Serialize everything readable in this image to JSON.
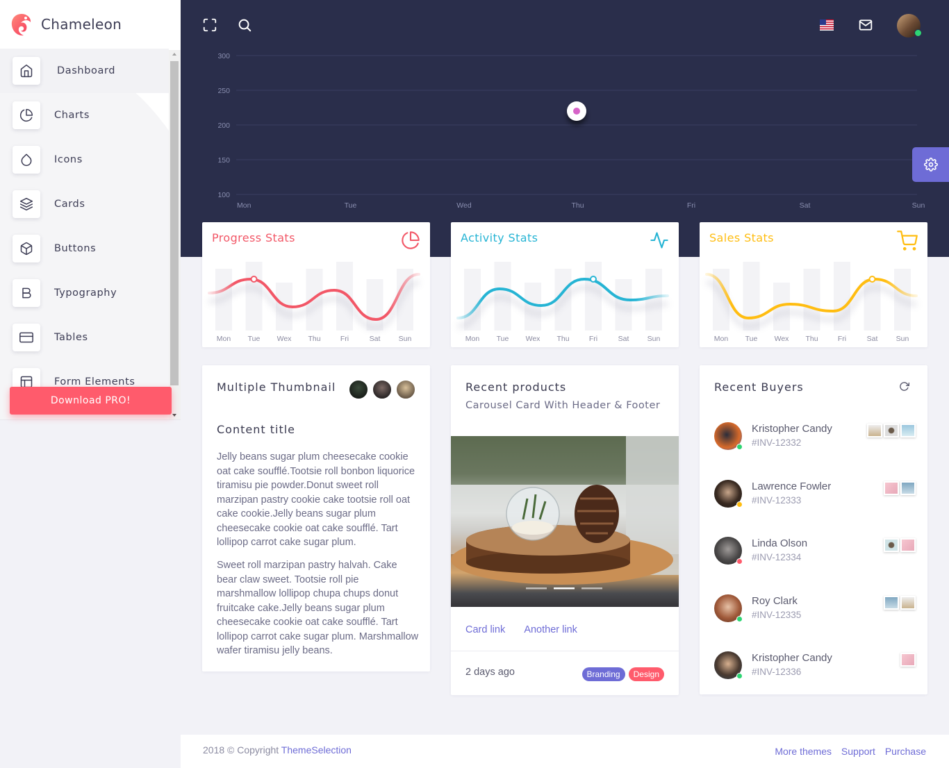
{
  "brand": {
    "name": "Chameleon"
  },
  "sidebar": {
    "items": [
      {
        "label": "Dashboard",
        "icon": "home-icon"
      },
      {
        "label": "Charts",
        "icon": "pie-chart-icon"
      },
      {
        "label": "Icons",
        "icon": "droplet-icon"
      },
      {
        "label": "Cards",
        "icon": "layers-icon"
      },
      {
        "label": "Buttons",
        "icon": "box-icon"
      },
      {
        "label": "Typography",
        "icon": "bold-icon"
      },
      {
        "label": "Tables",
        "icon": "credit-card-icon"
      },
      {
        "label": "Form Elements",
        "icon": "layout-icon"
      }
    ],
    "download_label": "Download PRO!"
  },
  "colors": {
    "accent": "#6e6cd6",
    "danger": "#ff5b6c",
    "info": "#26b4d4",
    "warning": "#ffbd11",
    "header": "#2a2e4b"
  },
  "main_chart": {
    "type": "line",
    "y_ticks": [
      "300",
      "250",
      "200",
      "150",
      "100"
    ],
    "x_ticks": [
      "Mon",
      "Tue",
      "Wed",
      "Thu",
      "Fri",
      "Sat",
      "Sun"
    ]
  },
  "stats": [
    {
      "title": "Progress Stats",
      "icon": "pie-chart-icon",
      "color": "#f25767"
    },
    {
      "title": "Activity Stats",
      "icon": "activity-icon",
      "color": "#26b4d4"
    },
    {
      "title": "Sales Stats",
      "icon": "shopping-cart-icon",
      "color": "#ffbd11"
    }
  ],
  "days": [
    "Mon",
    "Tue",
    "Wex",
    "Thu",
    "Fri",
    "Sat",
    "Sun"
  ],
  "thumbnail_card": {
    "title": "Multiple Thumbnail",
    "content_title": "Content title",
    "para1": "Jelly beans sugar plum cheesecake cookie oat cake soufflé.Tootsie roll bonbon liquorice tiramisu pie powder.Donut sweet roll marzipan pastry cookie cake tootsie roll oat cake cookie.Jelly beans sugar plum cheesecake cookie oat cake soufflé. Tart lollipop carrot cake sugar plum.",
    "para2": "Sweet roll marzipan pastry halvah. Cake bear claw sweet. Tootsie roll pie marshmallow lollipop chupa chups donut fruitcake cake.Jelly beans sugar plum cheesecake cookie oat cake soufflé. Tart lollipop carrot cake sugar plum. Marshmallow wafer tiramisu jelly beans."
  },
  "products_card": {
    "title": "Recent products",
    "subtitle": "Carousel Card With Header & Footer",
    "link1": "Card link",
    "link2": "Another link",
    "time": "2 days ago",
    "badge1": "Branding",
    "badge2": "Design"
  },
  "buyers_card": {
    "title": "Recent Buyers",
    "buyers": [
      {
        "name": "Kristopher Candy",
        "invoice": "#INV-12332",
        "status_color": "#2ed573"
      },
      {
        "name": "Lawrence Fowler",
        "invoice": "#INV-12333",
        "status_color": "#ffbd11"
      },
      {
        "name": "Linda Olson",
        "invoice": "#INV-12334",
        "status_color": "#ff5b6c"
      },
      {
        "name": "Roy Clark",
        "invoice": "#INV-12335",
        "status_color": "#2ed573"
      },
      {
        "name": "Kristopher Candy",
        "invoice": "#INV-12336",
        "status_color": "#2ed573"
      }
    ]
  },
  "footer": {
    "copyright": "2018 © Copyright",
    "brand_link": "ThemeSelection",
    "links": [
      "More themes",
      "Support",
      "Purchase"
    ]
  }
}
